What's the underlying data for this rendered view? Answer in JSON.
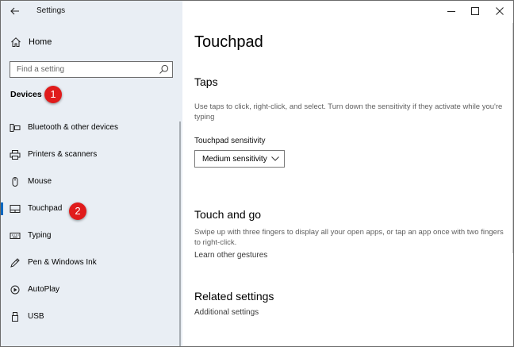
{
  "window": {
    "title": "Settings"
  },
  "sidebar": {
    "home_label": "Home",
    "search_placeholder": "Find a setting",
    "section_label": "Devices",
    "items": [
      {
        "label": "Bluetooth & other devices",
        "icon": "bluetooth-devices-icon"
      },
      {
        "label": "Printers & scanners",
        "icon": "printer-icon"
      },
      {
        "label": "Mouse",
        "icon": "mouse-icon"
      },
      {
        "label": "Touchpad",
        "icon": "touchpad-icon",
        "selected": true
      },
      {
        "label": "Typing",
        "icon": "keyboard-icon"
      },
      {
        "label": "Pen & Windows Ink",
        "icon": "pen-icon"
      },
      {
        "label": "AutoPlay",
        "icon": "autoplay-icon"
      },
      {
        "label": "USB",
        "icon": "usb-icon"
      }
    ]
  },
  "annotations": {
    "marker1": "1",
    "marker2": "2",
    "color": "#e01b1b"
  },
  "main": {
    "title": "Touchpad",
    "taps": {
      "heading": "Taps",
      "description": "Use taps to click, right-click, and select. Turn down the sensitivity if they activate while you're typing",
      "sensitivity_label": "Touchpad sensitivity",
      "sensitivity_value": "Medium sensitivity"
    },
    "touch_and_go": {
      "heading": "Touch and go",
      "description": "Swipe up with three fingers to display all your open apps, or tap an app once with two fingers to right-click.",
      "link": "Learn other gestures"
    },
    "related": {
      "heading": "Related settings",
      "link": "Additional settings"
    }
  },
  "colors": {
    "sidebar_bg": "#e9eef4",
    "accent": "#0067c0"
  }
}
